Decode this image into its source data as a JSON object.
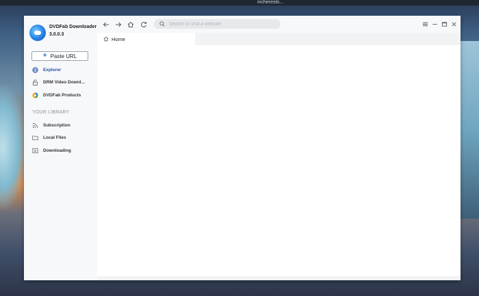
{
  "window_title": "incheresto...",
  "app": {
    "name": "DVDFab Downloader",
    "version": "3.0.0.3"
  },
  "sidebar": {
    "paste_url_label": "Paste URL",
    "items": [
      {
        "label": "Explorer",
        "icon": "globe-icon",
        "active": true
      },
      {
        "label": "DRM Video Downl...",
        "icon": "lock-icon",
        "active": false
      },
      {
        "label": "DVDFab Products",
        "icon": "dvdfab-icon",
        "active": false
      }
    ],
    "library_label": "YOUR LIBRARY",
    "library_items": [
      {
        "label": "Subscription",
        "icon": "rss-icon"
      },
      {
        "label": "Local Files",
        "icon": "folder-icon"
      },
      {
        "label": "Downloading",
        "icon": "download-list-icon"
      }
    ]
  },
  "toolbar": {
    "search_placeholder": "Search or visit a website"
  },
  "tabs": [
    {
      "label": "Home",
      "icon": "home-icon"
    }
  ],
  "colors": {
    "accent": "#1e4fa8",
    "sidebar_bg": "#f7f8fa"
  }
}
